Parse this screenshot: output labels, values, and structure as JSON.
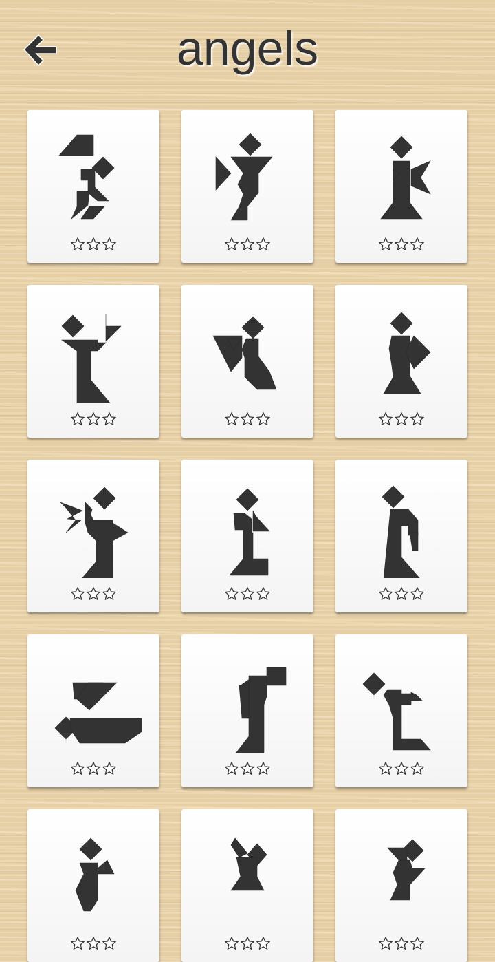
{
  "header": {
    "title": "angels",
    "back_icon": "arrow-left-icon"
  },
  "colors": {
    "shape": "#333333",
    "star_stroke": "#333333",
    "card": "#ffffff"
  },
  "puzzles": [
    {
      "id": "angel-1",
      "stars_earned": 0,
      "stars_total": 3
    },
    {
      "id": "angel-2",
      "stars_earned": 0,
      "stars_total": 3
    },
    {
      "id": "angel-3",
      "stars_earned": 0,
      "stars_total": 3
    },
    {
      "id": "angel-4",
      "stars_earned": 0,
      "stars_total": 3
    },
    {
      "id": "angel-5",
      "stars_earned": 0,
      "stars_total": 3
    },
    {
      "id": "angel-6",
      "stars_earned": 0,
      "stars_total": 3
    },
    {
      "id": "angel-7",
      "stars_earned": 0,
      "stars_total": 3
    },
    {
      "id": "angel-8",
      "stars_earned": 0,
      "stars_total": 3
    },
    {
      "id": "angel-9",
      "stars_earned": 0,
      "stars_total": 3
    },
    {
      "id": "angel-10",
      "stars_earned": 0,
      "stars_total": 3
    },
    {
      "id": "angel-11",
      "stars_earned": 0,
      "stars_total": 3
    },
    {
      "id": "angel-12",
      "stars_earned": 0,
      "stars_total": 3
    },
    {
      "id": "angel-13",
      "stars_earned": 0,
      "stars_total": 3
    },
    {
      "id": "angel-14",
      "stars_earned": 0,
      "stars_total": 3
    },
    {
      "id": "angel-15",
      "stars_earned": 0,
      "stars_total": 3
    }
  ]
}
